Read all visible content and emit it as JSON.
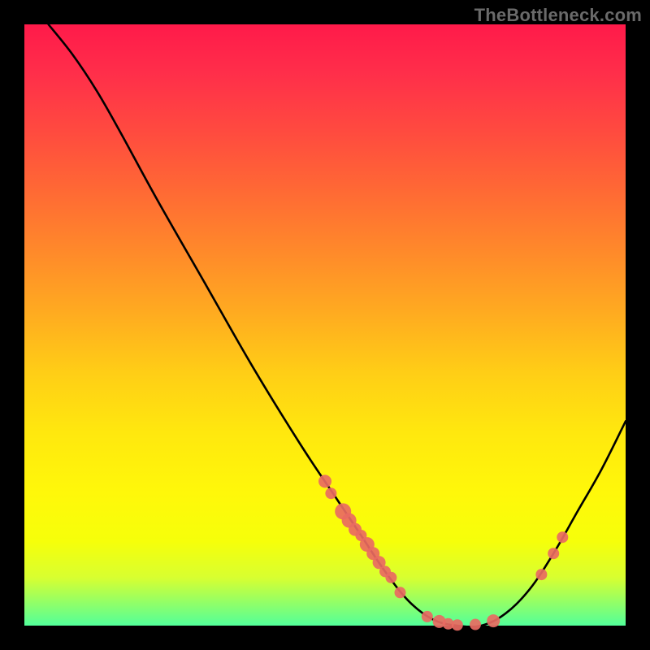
{
  "watermark": "TheBottleneck.com",
  "chart_data": {
    "type": "line",
    "title": "",
    "xlabel": "",
    "ylabel": "",
    "xlim": [
      0,
      100
    ],
    "ylim": [
      0,
      100
    ],
    "grid": false,
    "legend": false,
    "series": [
      {
        "name": "curve",
        "color": "#000000",
        "points": [
          {
            "x": 4,
            "y": 100
          },
          {
            "x": 8,
            "y": 95
          },
          {
            "x": 12,
            "y": 89
          },
          {
            "x": 16,
            "y": 82
          },
          {
            "x": 22,
            "y": 71
          },
          {
            "x": 30,
            "y": 57
          },
          {
            "x": 38,
            "y": 43
          },
          {
            "x": 46,
            "y": 30
          },
          {
            "x": 52,
            "y": 21
          },
          {
            "x": 56,
            "y": 15
          },
          {
            "x": 60,
            "y": 9
          },
          {
            "x": 64,
            "y": 4
          },
          {
            "x": 68,
            "y": 1
          },
          {
            "x": 72,
            "y": 0
          },
          {
            "x": 76,
            "y": 0
          },
          {
            "x": 80,
            "y": 2
          },
          {
            "x": 84,
            "y": 6
          },
          {
            "x": 88,
            "y": 12
          },
          {
            "x": 92,
            "y": 19
          },
          {
            "x": 96,
            "y": 26
          },
          {
            "x": 100,
            "y": 34
          }
        ]
      }
    ],
    "markers": {
      "color": "#e96a62",
      "radius_default": 7,
      "points": [
        {
          "x": 50,
          "y": 24,
          "r": 8
        },
        {
          "x": 51,
          "y": 22,
          "r": 7
        },
        {
          "x": 53,
          "y": 19,
          "r": 10
        },
        {
          "x": 54,
          "y": 17.5,
          "r": 9
        },
        {
          "x": 55,
          "y": 16,
          "r": 8
        },
        {
          "x": 56,
          "y": 15,
          "r": 7
        },
        {
          "x": 57,
          "y": 13.5,
          "r": 9
        },
        {
          "x": 58,
          "y": 12,
          "r": 8
        },
        {
          "x": 59,
          "y": 10.5,
          "r": 8
        },
        {
          "x": 60,
          "y": 9,
          "r": 7
        },
        {
          "x": 61,
          "y": 8,
          "r": 7
        },
        {
          "x": 62.5,
          "y": 5.5,
          "r": 7
        },
        {
          "x": 67,
          "y": 1.5,
          "r": 7
        },
        {
          "x": 69,
          "y": 0.7,
          "r": 8
        },
        {
          "x": 70.5,
          "y": 0.3,
          "r": 7
        },
        {
          "x": 72,
          "y": 0.1,
          "r": 7
        },
        {
          "x": 75,
          "y": 0.2,
          "r": 7
        },
        {
          "x": 78,
          "y": 0.8,
          "r": 8
        },
        {
          "x": 86,
          "y": 8.5,
          "r": 7
        },
        {
          "x": 88,
          "y": 12,
          "r": 7
        },
        {
          "x": 89.5,
          "y": 14.7,
          "r": 7
        }
      ]
    }
  }
}
